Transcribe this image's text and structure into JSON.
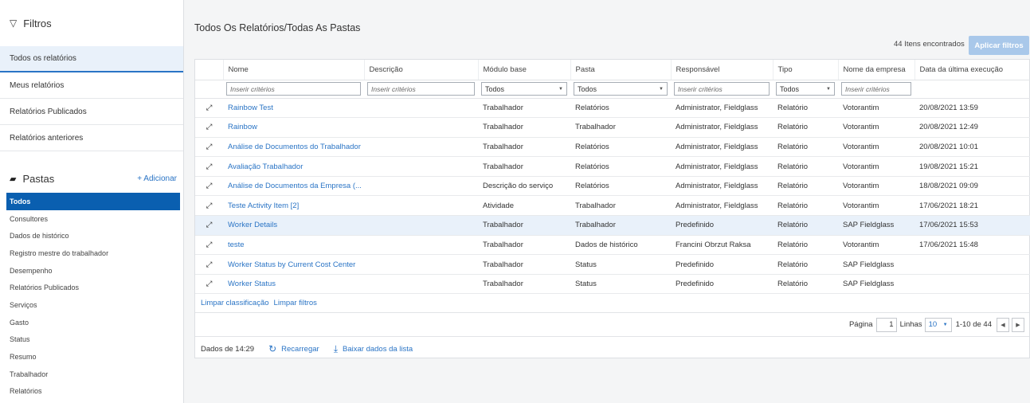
{
  "sidebar": {
    "filters_title": "Filtros",
    "nav": [
      {
        "label": "Todos os relatórios",
        "active": true
      },
      {
        "label": "Meus relatórios",
        "active": false
      },
      {
        "label": "Relatórios Publicados",
        "active": false
      },
      {
        "label": "Relatórios anteriores",
        "active": false
      }
    ],
    "folders_title": "Pastas",
    "add_label": "+ Adicionar",
    "folders": [
      {
        "label": "Todos",
        "active": true
      },
      {
        "label": "Consultores"
      },
      {
        "label": "Dados de histórico"
      },
      {
        "label": "Registro mestre do trabalhador"
      },
      {
        "label": "Desempenho"
      },
      {
        "label": "Relatórios Publicados"
      },
      {
        "label": "Serviços"
      },
      {
        "label": "Gasto"
      },
      {
        "label": "Status"
      },
      {
        "label": "Resumo"
      },
      {
        "label": "Trabalhador"
      },
      {
        "label": "Relatórios"
      }
    ]
  },
  "main": {
    "title": "Todos Os Relatórios/Todas As Pastas",
    "found": "44 Itens encontrados",
    "apply_button": "Aplicar filtros",
    "columns": [
      "Nome",
      "Descrição",
      "Módulo base",
      "Pasta",
      "Responsável",
      "Tipo",
      "Nome da empresa",
      "Data da última execução"
    ],
    "filters": {
      "nome_placeholder": "Inserir critérios",
      "descricao_placeholder": "Inserir critérios",
      "modulo_value": "Todos",
      "pasta_value": "Todos",
      "responsavel_placeholder": "Inserir critérios",
      "tipo_value": "Todos",
      "empresa_placeholder": "Inserir critérios"
    },
    "rows": [
      {
        "nome": "Rainbow Test",
        "descricao": "",
        "modulo": "Trabalhador",
        "pasta": "Relatórios",
        "responsavel": "Administrator, Fieldglass",
        "tipo": "Relatório",
        "empresa": "Votorantim",
        "data": "20/08/2021 13:59"
      },
      {
        "nome": "Rainbow",
        "descricao": "",
        "modulo": "Trabalhador",
        "pasta": "Trabalhador",
        "responsavel": "Administrator, Fieldglass",
        "tipo": "Relatório",
        "empresa": "Votorantim",
        "data": "20/08/2021 12:49"
      },
      {
        "nome": "Análise de Documentos do Trabalhador",
        "descricao": "",
        "modulo": "Trabalhador",
        "pasta": "Relatórios",
        "responsavel": "Administrator, Fieldglass",
        "tipo": "Relatório",
        "empresa": "Votorantim",
        "data": "20/08/2021 10:01"
      },
      {
        "nome": "Avaliação Trabalhador",
        "descricao": "",
        "modulo": "Trabalhador",
        "pasta": "Relatórios",
        "responsavel": "Administrator, Fieldglass",
        "tipo": "Relatório",
        "empresa": "Votorantim",
        "data": "19/08/2021 15:21"
      },
      {
        "nome": "Análise de Documentos da Empresa (...",
        "descricao": "",
        "modulo": "Descrição do serviço",
        "pasta": "Relatórios",
        "responsavel": "Administrator, Fieldglass",
        "tipo": "Relatório",
        "empresa": "Votorantim",
        "data": "18/08/2021 09:09"
      },
      {
        "nome": "Teste Activity Item [2]",
        "descricao": "",
        "modulo": "Atividade",
        "pasta": "Trabalhador",
        "responsavel": "Administrator, Fieldglass",
        "tipo": "Relatório",
        "empresa": "Votorantim",
        "data": "17/06/2021 18:21"
      },
      {
        "nome": "Worker Details",
        "descricao": "",
        "modulo": "Trabalhador",
        "pasta": "Trabalhador",
        "responsavel": "Predefinido",
        "tipo": "Relatório",
        "empresa": "SAP Fieldglass",
        "data": "17/06/2021 15:53",
        "highlight": true
      },
      {
        "nome": "teste",
        "descricao": "",
        "modulo": "Trabalhador",
        "pasta": "Dados de histórico",
        "responsavel": "Francini Obrzut Raksa",
        "tipo": "Relatório",
        "empresa": "Votorantim",
        "data": "17/06/2021 15:48"
      },
      {
        "nome": "Worker Status by Current Cost Center",
        "descricao": "",
        "modulo": "Trabalhador",
        "pasta": "Status",
        "responsavel": "Predefinido",
        "tipo": "Relatório",
        "empresa": "SAP Fieldglass",
        "data": ""
      },
      {
        "nome": "Worker Status",
        "descricao": "",
        "modulo": "Trabalhador",
        "pasta": "Status",
        "responsavel": "Predefinido",
        "tipo": "Relatório",
        "empresa": "SAP Fieldglass",
        "data": ""
      }
    ],
    "clear_sort": "Limpar classificação",
    "clear_filters": "Limpar filtros",
    "pager": {
      "page_label": "Página",
      "page_value": "1",
      "rows_label": "Linhas",
      "rows_value": "10",
      "range": "1-10 de 44"
    },
    "status": {
      "data_time": "Dados de 14:29",
      "reload": "Recarregar",
      "download": "Baixar dados da lista"
    }
  }
}
